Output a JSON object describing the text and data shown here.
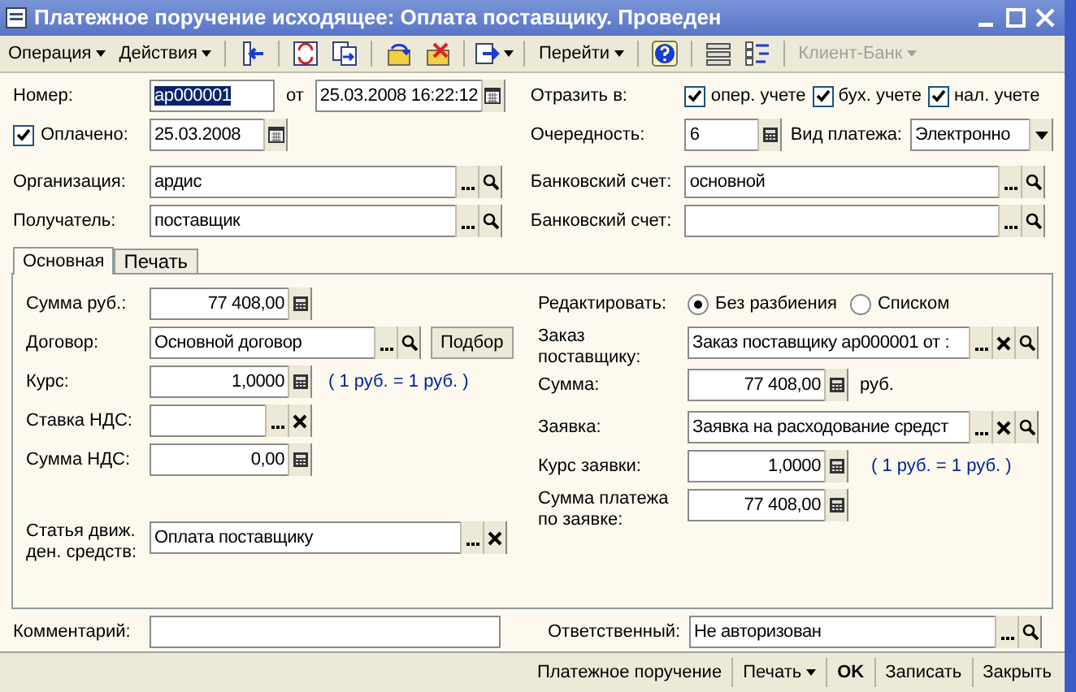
{
  "window": {
    "title": "Платежное поручение исходящее: Оплата поставщику. Проведен"
  },
  "toolbar": {
    "menus": [
      {
        "label": "Операция"
      },
      {
        "label": "Действия"
      }
    ],
    "goto": {
      "label": "Перейти"
    },
    "client_bank": {
      "label": "Клиент-Банк",
      "disabled": true
    }
  },
  "header": {
    "number": {
      "label": "Номер:",
      "value": "ар000001",
      "selected": true
    },
    "date": {
      "label": "от",
      "value": "25.03.2008 16:22:12"
    },
    "paid": {
      "label": "Оплачено:",
      "checked": true,
      "value": "25.03.2008"
    },
    "organization": {
      "label": "Организация:",
      "value": "ардис"
    },
    "recipient": {
      "label": "Получатель:",
      "value": "поставщик"
    },
    "reflect": {
      "label": "Отразить в:",
      "options": [
        {
          "label": "опер. учете",
          "checked": true
        },
        {
          "label": "бух. учете",
          "checked": true
        },
        {
          "label": "нал. учете",
          "checked": true
        }
      ]
    },
    "priority": {
      "label": "Очередность:",
      "value": "6"
    },
    "payment_type": {
      "label": "Вид платежа:",
      "value": "Электронно"
    },
    "bank_account": {
      "label": "Банковский счет:",
      "value": "основной"
    },
    "recipient_account": {
      "label": "Банковский счет:"
    }
  },
  "tabs": [
    {
      "label": "Основная",
      "selected": true
    },
    {
      "label": "Печать",
      "selected": false
    }
  ],
  "main": {
    "amount": {
      "label": "Сумма руб.:",
      "value": "77 408,00"
    },
    "contract": {
      "label": "Договор:",
      "value": "Основной договор",
      "pick_button": "Подбор"
    },
    "rate": {
      "label": "Курс:",
      "value": "1,0000",
      "note": "( 1 руб. = 1 руб. )"
    },
    "vat_rate": {
      "label": "Ставка НДС:"
    },
    "vat_amount": {
      "label": "Сумма НДС:",
      "value": "0,00"
    },
    "cash_item": {
      "label": "Статья движ. ден. средств:",
      "value": "Оплата поставщику"
    },
    "edit_mode": {
      "label": "Редактировать:",
      "options": [
        {
          "label": "Без разбиения",
          "selected": true
        },
        {
          "label": "Списком",
          "selected": false
        }
      ]
    },
    "order": {
      "label": "Заказ поставщику:",
      "value": "Заказ поставщику ар000001 от :"
    },
    "order_sum": {
      "label": "Сумма:",
      "value": "77 408,00",
      "unit": "руб."
    },
    "request": {
      "label": "Заявка:",
      "value": "Заявка на расходование средст"
    },
    "request_rate": {
      "label": "Курс заявки:",
      "value": "1,0000",
      "note": "( 1 руб. = 1 руб. )"
    },
    "request_sum": {
      "label": "Сумма платежа по заявке:",
      "value": "77 408,00"
    }
  },
  "comment": {
    "label": "Комментарий:"
  },
  "responsible": {
    "label": "Ответственный:",
    "value": "Не авторизован"
  },
  "footer": [
    {
      "label": "Платежное поручение",
      "kind": "plain"
    },
    {
      "label": "Печать",
      "kind": "menu"
    },
    {
      "label": "OK",
      "kind": "default"
    },
    {
      "label": "Записать",
      "kind": "plain"
    },
    {
      "label": "Закрыть",
      "kind": "plain"
    }
  ]
}
